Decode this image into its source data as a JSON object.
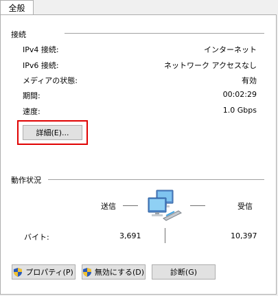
{
  "tab": {
    "label": "全般"
  },
  "connection": {
    "title": "接続",
    "rows": [
      {
        "label": "IPv4 接続:",
        "value": "インターネット"
      },
      {
        "label": "IPv6 接続:",
        "value": "ネットワーク アクセスなし"
      },
      {
        "label": "メディアの状態:",
        "value": "有効"
      },
      {
        "label": "期間:",
        "value": "00:02:29"
      },
      {
        "label": "速度:",
        "value": "1.0 Gbps"
      }
    ],
    "details_button": "詳細(E)..."
  },
  "activity": {
    "title": "動作状況",
    "sent_label": "送信",
    "received_label": "受信",
    "bytes_label": "バイト:",
    "sent_value": "3,691",
    "received_value": "10,397"
  },
  "buttons": {
    "properties": "プロパティ(P)",
    "disable": "無効にする(D)",
    "diagnose": "診断(G)"
  },
  "icons": {
    "network": "network-computers-icon",
    "shield": "uac-shield-icon"
  }
}
